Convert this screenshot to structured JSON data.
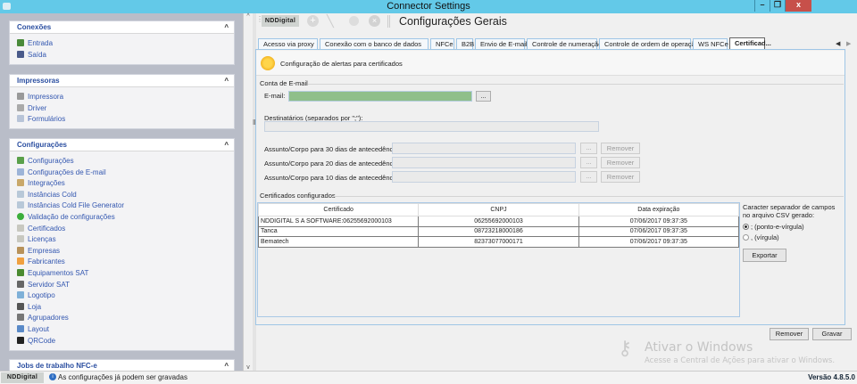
{
  "window": {
    "title": "Connector Settings",
    "controls": [
      "minimize",
      "restore",
      "close"
    ]
  },
  "sidebar": {
    "panels": [
      {
        "title": "Conexões",
        "items": [
          {
            "label": "Entrada",
            "icon": "entrada-icon"
          },
          {
            "label": "Saída",
            "icon": "saida-icon"
          }
        ]
      },
      {
        "title": "Impressoras",
        "items": [
          {
            "label": "Impressora",
            "icon": "printer-icon"
          },
          {
            "label": "Driver",
            "icon": "driver-icon"
          },
          {
            "label": "Formulários",
            "icon": "form-icon"
          }
        ]
      },
      {
        "title": "Configurações",
        "items": [
          {
            "label": "Configurações",
            "icon": "settings-icon"
          },
          {
            "label": "Configurações de E-mail",
            "icon": "email-icon"
          },
          {
            "label": "Integrações",
            "icon": "integration-icon"
          },
          {
            "label": "Instâncias Cold",
            "icon": "instance-icon"
          },
          {
            "label": "Instâncias Cold File Generator",
            "icon": "instance-icon"
          },
          {
            "label": "Validação de configurações",
            "icon": "check-icon"
          },
          {
            "label": "Certificados",
            "icon": "certificate-icon"
          },
          {
            "label": "Licenças",
            "icon": "license-icon"
          },
          {
            "label": "Empresas",
            "icon": "company-icon"
          },
          {
            "label": "Fabricantes",
            "icon": "manufacturer-icon"
          },
          {
            "label": "Equipamentos SAT",
            "icon": "equipment-icon"
          },
          {
            "label": "Servidor SAT",
            "icon": "server-icon"
          },
          {
            "label": "Logotipo",
            "icon": "logo-icon"
          },
          {
            "label": "Loja",
            "icon": "store-icon"
          },
          {
            "label": "Agrupadores",
            "icon": "group-icon"
          },
          {
            "label": "Layout",
            "icon": "layout-icon"
          },
          {
            "label": "QRCode",
            "icon": "qrcode-icon"
          }
        ]
      },
      {
        "title": "Jobs de trabalho NFC-e",
        "items": []
      }
    ]
  },
  "toolbar": {
    "brand": "NDDigital",
    "page_title": "Configurações Gerais"
  },
  "tabs": [
    "Acesso via proxy",
    "Conexão com o banco de dados",
    "NFCe",
    "B2B",
    "Envio de E-mail",
    "Controle de numeração",
    "Controle de ordem de operação",
    "WS NFCe",
    "Certificad..."
  ],
  "active_tab": 8,
  "content": {
    "header": "Configuração de alertas para certificados",
    "email_group": {
      "title": "Conta de E-mail",
      "email_label": "E-mail:",
      "email_value": "",
      "browse": "...",
      "recipients_label": "Destinatários (separados por \";\"):",
      "recipients_value": "",
      "rows": [
        {
          "label": "Assunto/Corpo para 30 dias de antecedência:",
          "browse": "...",
          "remove": "Remover"
        },
        {
          "label": "Assunto/Corpo para 20 dias de antecedência:",
          "browse": "...",
          "remove": "Remover"
        },
        {
          "label": "Assunto/Corpo para 10 dias de antecedência:",
          "browse": "...",
          "remove": "Remover"
        }
      ]
    },
    "certs_group": {
      "title": "Certificados configurados",
      "columns": [
        "Certificado",
        "CNPJ",
        "Data expiração"
      ],
      "rows": [
        [
          "NDDIGITAL S A SOFTWARE:06255692000103",
          "06255692000103",
          "07/06/2017 09:37:35"
        ],
        [
          "Tanca",
          "08723218000186",
          "07/06/2017 09:37:35"
        ],
        [
          "Bematech",
          "82373077000171",
          "07/06/2017 09:37:35"
        ]
      ],
      "csv_label": "Caracter separador de campos no arquivo CSV gerado:",
      "options": [
        {
          "label": "; (ponto-e-vírgula)",
          "selected": true
        },
        {
          "label": ", (vírgula)",
          "selected": false
        }
      ],
      "export": "Exportar"
    }
  },
  "footer": {
    "remove": "Remover",
    "save": "Gravar"
  },
  "watermark": {
    "title": "Ativar o Windows",
    "subtitle": "Acesse a Central de Ações para ativar o Windows."
  },
  "statusbar": {
    "brand": "NDDigital",
    "message": "As configurações já podem ser gravadas",
    "version": "Versão 4.8.5.0"
  },
  "colors": {
    "titlebar": "#63c9e8",
    "email_field": "#8fbf8a",
    "sidebar_link": "#3357b0"
  }
}
